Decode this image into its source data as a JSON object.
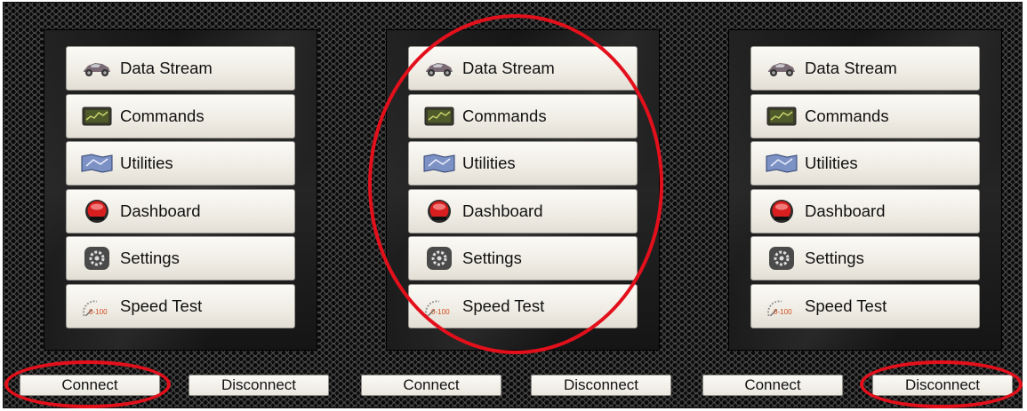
{
  "panels": [
    {
      "menu": [
        {
          "label": "Data Stream",
          "icon": "car-icon"
        },
        {
          "label": "Commands",
          "icon": "monitor-icon"
        },
        {
          "label": "Utilities",
          "icon": "map-icon"
        },
        {
          "label": "Dashboard",
          "icon": "red-gauge-icon"
        },
        {
          "label": "Settings",
          "icon": "gear-icon"
        },
        {
          "label": "Speed Test",
          "icon": "speedometer-icon"
        }
      ]
    },
    {
      "menu": [
        {
          "label": "Data Stream",
          "icon": "car-icon"
        },
        {
          "label": "Commands",
          "icon": "monitor-icon"
        },
        {
          "label": "Utilities",
          "icon": "map-icon"
        },
        {
          "label": "Dashboard",
          "icon": "red-gauge-icon"
        },
        {
          "label": "Settings",
          "icon": "gear-icon"
        },
        {
          "label": "Speed Test",
          "icon": "speedometer-icon"
        }
      ]
    },
    {
      "menu": [
        {
          "label": "Data Stream",
          "icon": "car-icon"
        },
        {
          "label": "Commands",
          "icon": "monitor-icon"
        },
        {
          "label": "Utilities",
          "icon": "map-icon"
        },
        {
          "label": "Dashboard",
          "icon": "red-gauge-icon"
        },
        {
          "label": "Settings",
          "icon": "gear-icon"
        },
        {
          "label": "Speed Test",
          "icon": "speedometer-icon"
        }
      ]
    }
  ],
  "bottom_buttons": [
    "Connect",
    "Disconnect",
    "Connect",
    "Disconnect",
    "Connect",
    "Disconnect"
  ],
  "speed_icon_text": "0-100",
  "colors": {
    "annotation_red": "#e3101c",
    "button_face": "#efece4",
    "background": "#2b2b2b"
  }
}
